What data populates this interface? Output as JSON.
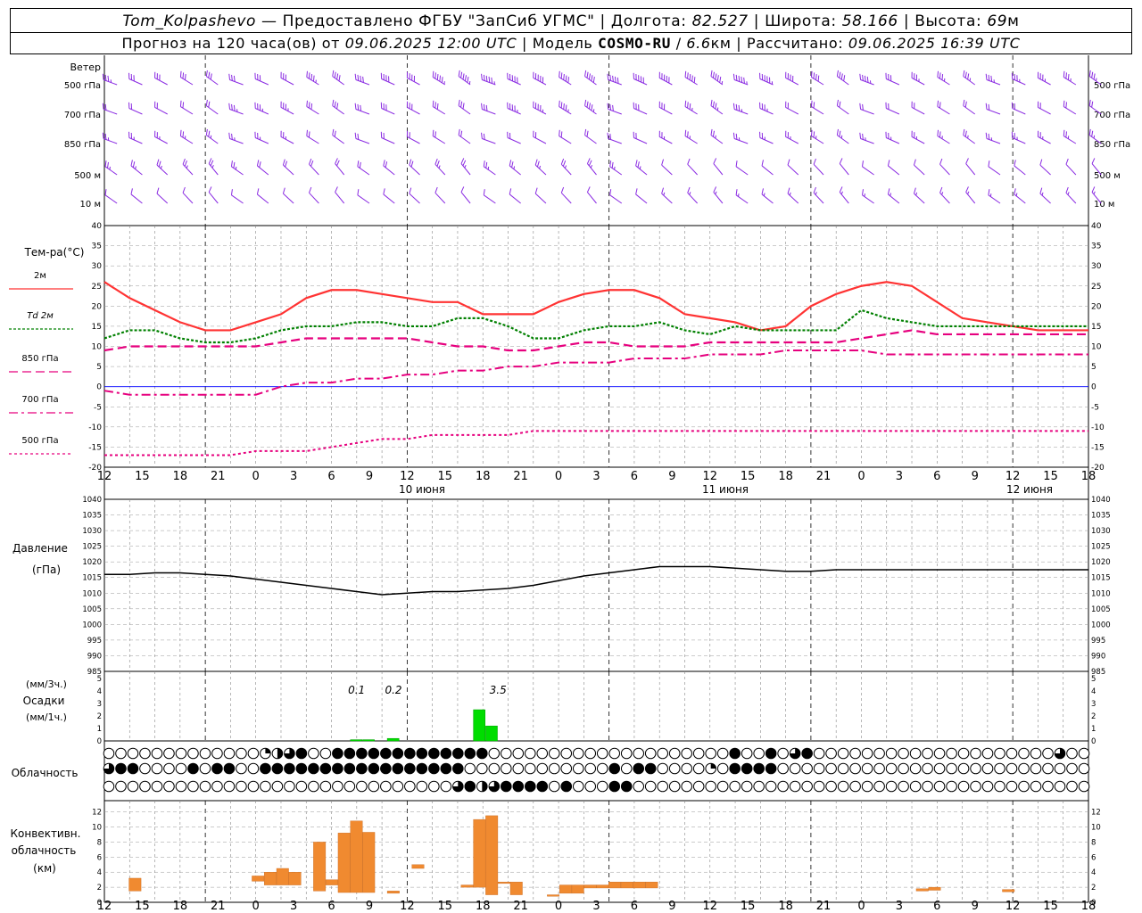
{
  "header": {
    "station": "Tom_Kolpashevo",
    "provider": "— Предоставлено ФГБУ \"ЗапСиб УГМС\"",
    "lon_label": "Долгота:",
    "lon": "82.527",
    "lat_label": "Широта:",
    "lat": "58.166",
    "alt_label": "Высота:",
    "alt": "69",
    "alt_unit": "м",
    "forecast_label": "Прогноз на 120 часа(ов) от",
    "forecast_start": "09.06.2025 12:00 UTC",
    "model_label": "Модель",
    "model": "COSMO-RU",
    "resolution": "6.6",
    "res_unit": "км",
    "computed_label": "Рассчитано:",
    "computed": "09.06.2025 16:39 UTC"
  },
  "labels": {
    "wind": "Ветер",
    "wind_levels": [
      "500 гПа",
      "700 гПа",
      "850 гПа",
      "500 м",
      "10   м"
    ],
    "temp_title": "Тем-ра(°C)",
    "temp_legend": [
      "2м",
      "Td  2м",
      "850 гПа",
      "700 гПа",
      "500 гПа"
    ],
    "pressure_title": "Давление",
    "pressure_unit": "(гПа)",
    "precip_unit1": "(мм/3ч.)",
    "precip_title": "Осадки",
    "precip_unit2": "(мм/1ч.)",
    "cloud_title": "Облачность",
    "conv_title1": "Конвективн.",
    "conv_title2": "облачность",
    "conv_unit": "(км)"
  },
  "colors": {
    "t2m": "#ff3333",
    "td2m": "#008000",
    "t850": "#e6007e",
    "t700": "#e6007e",
    "t500": "#e6007e",
    "wind": "#8a2be2",
    "precip": "#00dd00",
    "conv": "#f08a30",
    "zero_line": "#0000ff"
  },
  "chart_data": [
    {
      "type": "line",
      "title": "Тем-ра(°C)",
      "x": [
        0,
        3,
        6,
        9,
        12,
        15,
        18,
        21,
        24,
        27,
        30,
        33,
        36,
        39,
        42,
        45,
        48,
        51,
        54,
        57,
        60,
        63,
        66,
        69,
        72,
        75,
        78,
        81,
        84,
        87,
        90,
        93,
        96,
        99,
        102,
        105,
        108,
        111,
        114,
        117
      ],
      "x_tick_labels": [
        "12",
        "15",
        "18",
        "21",
        "0",
        "3",
        "6",
        "9",
        "12",
        "15",
        "18",
        "21",
        "0",
        "3",
        "6",
        "9",
        "12",
        "15",
        "18",
        "21",
        "0",
        "3",
        "6",
        "9",
        "12",
        "15",
        "18"
      ],
      "day_labels": [
        "10 июня",
        "11 июня",
        "12 июня"
      ],
      "ylim": [
        -20,
        40
      ],
      "y_ticks": [
        40,
        35,
        30,
        25,
        20,
        15,
        10,
        5,
        0,
        -5,
        -10,
        -15,
        -20
      ],
      "series": [
        {
          "name": "2м",
          "values": [
            26,
            22,
            19,
            16,
            14,
            14,
            16,
            18,
            22,
            24,
            24,
            23,
            22,
            21,
            21,
            18,
            18,
            18,
            21,
            23,
            24,
            24,
            22,
            18,
            17,
            16,
            14,
            15,
            20,
            23,
            25,
            26,
            25,
            21,
            17,
            16,
            15,
            14,
            14,
            14
          ]
        },
        {
          "name": "Td 2м",
          "values": [
            12,
            14,
            14,
            12,
            11,
            11,
            12,
            14,
            15,
            15,
            16,
            16,
            15,
            15,
            17,
            17,
            15,
            12,
            12,
            14,
            15,
            15,
            16,
            14,
            13,
            15,
            14,
            14,
            14,
            14,
            19,
            17,
            16,
            15,
            15,
            15,
            15,
            15,
            15,
            15
          ]
        },
        {
          "name": "850 гПа",
          "values": [
            9,
            10,
            10,
            10,
            10,
            10,
            10,
            11,
            12,
            12,
            12,
            12,
            12,
            11,
            10,
            10,
            9,
            9,
            10,
            11,
            11,
            10,
            10,
            10,
            11,
            11,
            11,
            11,
            11,
            11,
            12,
            13,
            14,
            13,
            13,
            13,
            13,
            13,
            13,
            13
          ]
        },
        {
          "name": "700 гПа",
          "values": [
            -1,
            -2,
            -2,
            -2,
            -2,
            -2,
            -2,
            0,
            1,
            1,
            2,
            2,
            3,
            3,
            4,
            4,
            5,
            5,
            6,
            6,
            6,
            7,
            7,
            7,
            8,
            8,
            8,
            9,
            9,
            9,
            9,
            8,
            8,
            8,
            8,
            8,
            8,
            8,
            8,
            8
          ]
        },
        {
          "name": "500 гПа",
          "values": [
            -17,
            -17,
            -17,
            -17,
            -17,
            -17,
            -16,
            -16,
            -16,
            -15,
            -14,
            -13,
            -13,
            -12,
            -12,
            -12,
            -12,
            -11,
            -11,
            -11,
            -11,
            -11,
            -11,
            -11,
            -11,
            -11,
            -11,
            -11,
            -11,
            -11,
            -11,
            -11,
            -11,
            -11,
            -11,
            -11,
            -11,
            -11,
            -11,
            -11
          ]
        }
      ]
    },
    {
      "type": "line",
      "title": "Давление",
      "ylabel": "(гПа)",
      "ylim": [
        985,
        1040
      ],
      "y_ticks": [
        1040,
        1035,
        1030,
        1025,
        1020,
        1015,
        1010,
        1005,
        1000,
        995,
        990,
        985
      ],
      "x": [
        0,
        3,
        6,
        9,
        12,
        15,
        18,
        21,
        24,
        27,
        30,
        33,
        36,
        39,
        42,
        45,
        48,
        51,
        54,
        57,
        60,
        63,
        66,
        69,
        72,
        75,
        78,
        81,
        84,
        87,
        90,
        93,
        96,
        99,
        102,
        105,
        108,
        111,
        114,
        117
      ],
      "series": [
        {
          "name": "",
          "values": [
            1016,
            1016,
            1016.5,
            1016.5,
            1016,
            1015.5,
            1014.5,
            1013.5,
            1012.5,
            1011.5,
            1010.5,
            1009.5,
            1010,
            1010.5,
            1010.5,
            1011,
            1011.5,
            1012.5,
            1014,
            1015.5,
            1016.5,
            1017.5,
            1018.5,
            1018.5,
            1018.5,
            1018,
            1017.5,
            1017,
            1017,
            1017.5,
            1017.5,
            1017.5,
            1017.5,
            1017.5,
            1017.5,
            1017.5,
            1017.5,
            1017.5,
            1017.5,
            1017.5
          ]
        }
      ]
    },
    {
      "type": "bar",
      "title": "Осадки",
      "ylim": [
        0,
        5
      ],
      "y_ticks": [
        5,
        4,
        3,
        2,
        1,
        0
      ],
      "bars": [
        {
          "x": 20,
          "value": 0.1
        },
        {
          "x": 21,
          "value": 0.1
        },
        {
          "x": 23,
          "value": 0.2
        },
        {
          "x": 30,
          "value": 2.5
        },
        {
          "x": 31,
          "value": 1.2
        }
      ],
      "annotations": [
        {
          "x": 20.5,
          "text": "0.1"
        },
        {
          "x": 23.5,
          "text": "0.2"
        },
        {
          "x": 32,
          "text": "3.5"
        }
      ]
    },
    {
      "type": "bar",
      "title": "Конвективн. облачность",
      "ylabel": "(км)",
      "ylim": [
        0,
        13
      ],
      "y_ticks": [
        12,
        10,
        8,
        6,
        4,
        2,
        0
      ],
      "bars": [
        {
          "x": 2,
          "base": 1.5,
          "top": 3.2
        },
        {
          "x": 12,
          "base": 2.8,
          "top": 3.5
        },
        {
          "x": 13,
          "base": 2.3,
          "top": 4
        },
        {
          "x": 14,
          "base": 2.3,
          "top": 4.5
        },
        {
          "x": 15,
          "base": 2.3,
          "top": 4
        },
        {
          "x": 17,
          "base": 1.5,
          "top": 8
        },
        {
          "x": 18,
          "base": 2.3,
          "top": 3
        },
        {
          "x": 19,
          "base": 1.3,
          "top": 9.2
        },
        {
          "x": 20,
          "base": 1.3,
          "top": 10.8
        },
        {
          "x": 21,
          "base": 1.3,
          "top": 9.3
        },
        {
          "x": 23,
          "base": 1.2,
          "top": 1.5
        },
        {
          "x": 25,
          "base": 4.5,
          "top": 5
        },
        {
          "x": 29,
          "base": 2,
          "top": 2.3
        },
        {
          "x": 30,
          "base": 2,
          "top": 11
        },
        {
          "x": 31,
          "base": 1,
          "top": 11.5
        },
        {
          "x": 32,
          "base": 2.5,
          "top": 2.7
        },
        {
          "x": 33,
          "base": 1,
          "top": 2.7
        },
        {
          "x": 36,
          "base": 0.8,
          "top": 1
        },
        {
          "x": 37,
          "base": 1.2,
          "top": 2.3
        },
        {
          "x": 38,
          "base": 1.2,
          "top": 2.3
        },
        {
          "x": 39,
          "base": 1.9,
          "top": 2.3
        },
        {
          "x": 40,
          "base": 1.9,
          "top": 2.3
        },
        {
          "x": 41,
          "base": 1.9,
          "top": 2.7
        },
        {
          "x": 42,
          "base": 1.9,
          "top": 2.7
        },
        {
          "x": 43,
          "base": 1.9,
          "top": 2.7
        },
        {
          "x": 44,
          "base": 1.9,
          "top": 2.7
        },
        {
          "x": 66,
          "base": 1.5,
          "top": 1.8
        },
        {
          "x": 67,
          "base": 1.6,
          "top": 2
        },
        {
          "x": 73,
          "base": 1.4,
          "top": 1.7
        }
      ]
    }
  ],
  "cloud_rows": [
    "0000000000000123400444444444444400000000000000000000400403400000000000000000000300",
    "3440000404400444444444444444440000000000004044000010444400000000000000000000000000",
    "0000000000000000000000000000034234444040004400000000000000000000000000000000000000"
  ],
  "wind_levels_data": {
    "500 гПа": [
      25,
      30,
      30,
      30,
      30,
      30,
      30,
      30,
      35,
      40,
      40,
      40,
      40,
      45,
      45,
      45,
      50,
      50,
      50,
      50,
      50,
      50,
      50,
      50,
      45,
      45,
      45,
      40,
      40,
      40,
      35,
      30,
      25,
      25,
      25,
      25,
      25,
      25,
      25,
      25
    ],
    "700 гПа": [
      20,
      20,
      20,
      20,
      20,
      25,
      25,
      25,
      30,
      30,
      30,
      30,
      30,
      30,
      30,
      30,
      35,
      35,
      35,
      35,
      30,
      30,
      30,
      25,
      25,
      25,
      25,
      20,
      20,
      20,
      20,
      20,
      20,
      20,
      20,
      20,
      20,
      20,
      20,
      20
    ],
    "850 гПа": [
      15,
      15,
      15,
      15,
      15,
      15,
      15,
      15,
      20,
      20,
      20,
      20,
      20,
      20,
      20,
      20,
      20,
      20,
      20,
      20,
      20,
      20,
      15,
      15,
      15,
      15,
      15,
      15,
      15,
      15,
      15,
      15,
      15,
      15,
      15,
      15,
      15,
      15,
      15,
      15
    ],
    "500 м": [
      15,
      15,
      15,
      15,
      15,
      15,
      20,
      20,
      20,
      20,
      20,
      20,
      20,
      15,
      15,
      15,
      15,
      15,
      15,
      15,
      15,
      15,
      10,
      10,
      10,
      10,
      10,
      10,
      10,
      10,
      10,
      10,
      10,
      10,
      10,
      10,
      10,
      10,
      10,
      10
    ],
    "10   м": [
      10,
      10,
      10,
      10,
      10,
      10,
      10,
      10,
      10,
      10,
      10,
      10,
      10,
      10,
      10,
      10,
      10,
      10,
      10,
      10,
      10,
      10,
      5,
      5,
      5,
      5,
      5,
      5,
      5,
      5,
      5,
      5,
      5,
      5,
      5,
      5,
      5,
      5,
      5,
      5
    ]
  }
}
